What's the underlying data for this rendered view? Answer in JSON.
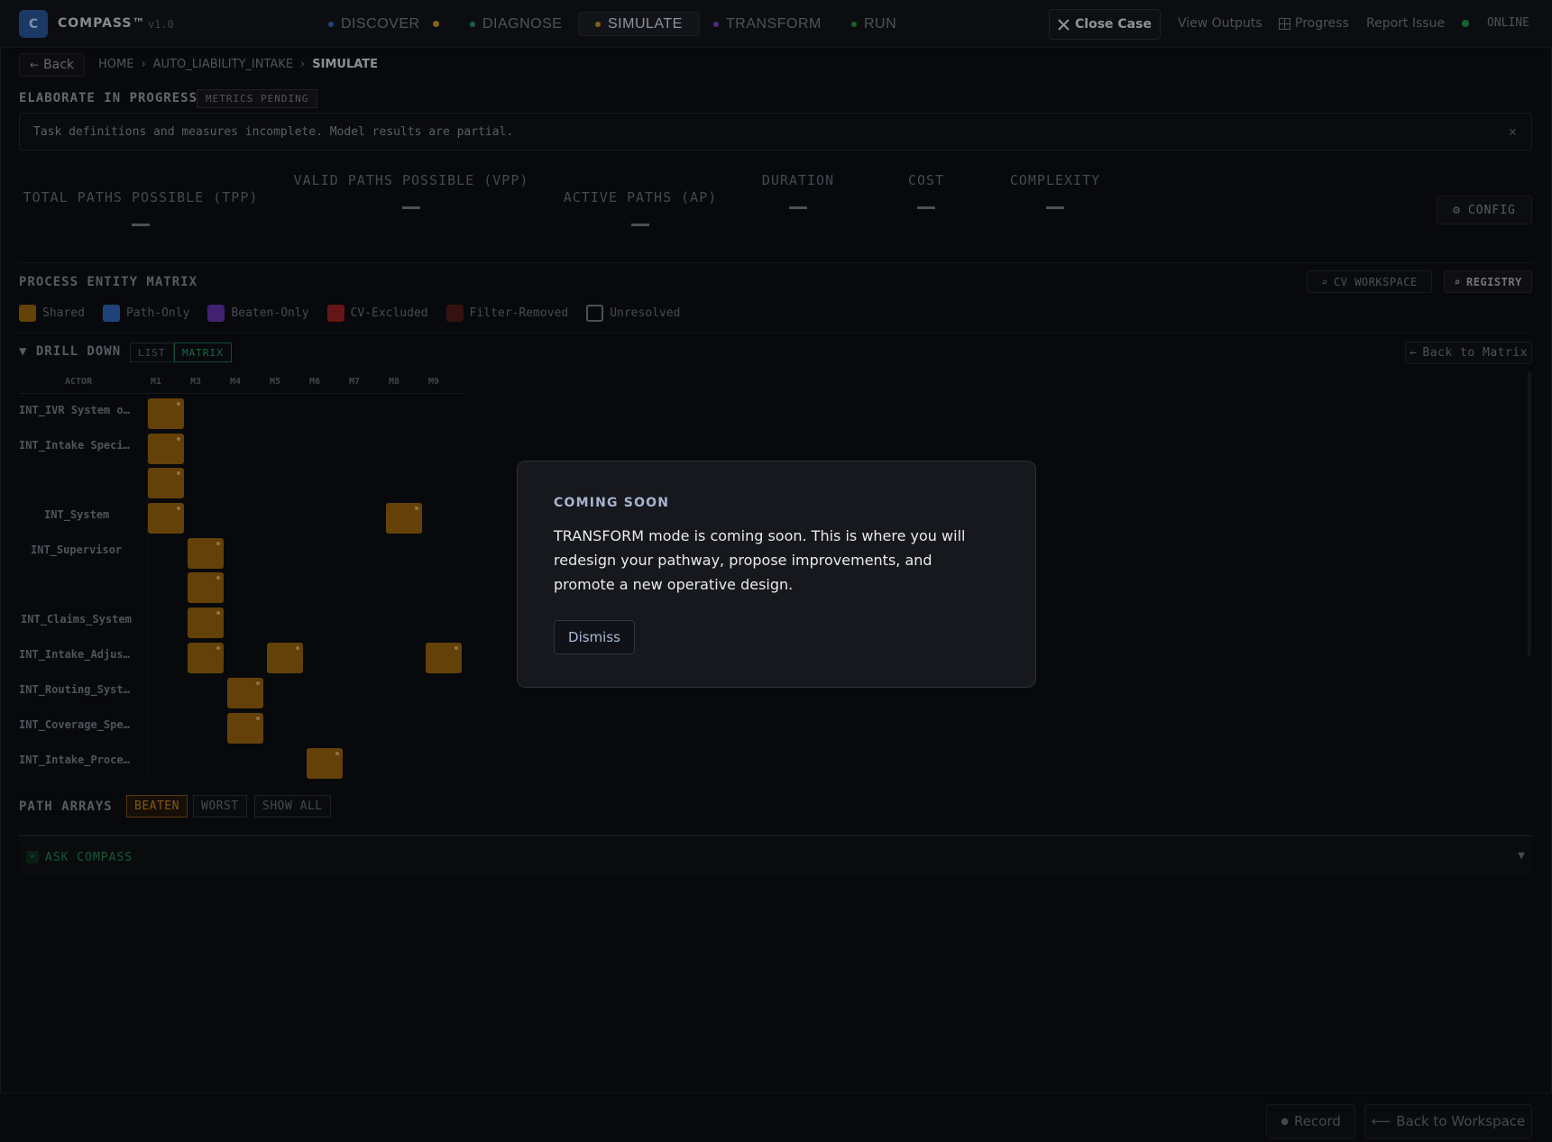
{
  "app": {
    "logo_letter": "C",
    "name": "COMPASS™",
    "version": "v1.0"
  },
  "modes": [
    {
      "label": "DISCOVER",
      "dot_color": "#2a5ea8",
      "trailing_dot": true
    },
    {
      "label": "DIAGNOSE",
      "dot_color": "#1e8a56",
      "trailing_dot": false
    },
    {
      "label": "SIMULATE",
      "dot_color": "#b8862a",
      "trailing_dot": false,
      "active": true
    },
    {
      "label": "TRANSFORM",
      "dot_color": "#6a3bb5",
      "trailing_dot": false
    },
    {
      "label": "RUN",
      "dot_color": "#1e8a3e",
      "trailing_dot": false
    }
  ],
  "topbar": {
    "close_case": "Close Case",
    "view_outputs": "View Outputs",
    "progress": "Progress",
    "report_issue": "Report Issue",
    "status": "ONLINE"
  },
  "breadcrumb": {
    "back": "Back",
    "items": [
      "HOME",
      "AUTO_LIABILITY_INTAKE",
      "SIMULATE"
    ]
  },
  "status": {
    "title": "ELABORATE IN PROGRESS",
    "badge": "METRICS PENDING",
    "notice": "Task definitions and measures incomplete. Model results are partial.",
    "dismiss_glyph": "×"
  },
  "metrics": [
    {
      "label": "TOTAL PATHS POSSIBLE (TPP)",
      "value": ""
    },
    {
      "label": "VALID PATHS POSSIBLE (VPP)",
      "value": ""
    },
    {
      "label": "ACTIVE PATHS (AP)",
      "value": ""
    },
    {
      "label": "DURATION",
      "value": ""
    },
    {
      "label": "COST",
      "value": ""
    },
    {
      "label": "COMPLEXITY",
      "value": ""
    }
  ],
  "config_label": "CONFIG",
  "matrix": {
    "title": "PROCESS ENTITY MATRIX",
    "cv_workspace": "CV WORKSPACE",
    "registry": "REGISTRY",
    "legend": [
      {
        "label": "Shared",
        "color": "#8a5a0d"
      },
      {
        "label": "Path-Only",
        "color": "#2a5ea8"
      },
      {
        "label": "Beaten-Only",
        "color": "#5b2f9c"
      },
      {
        "label": "CV-Excluded",
        "color": "#8c1f1f"
      },
      {
        "label": "Filter-Removed",
        "color": "#4a1a1a"
      },
      {
        "label": "Unresolved",
        "color": "outline"
      }
    ],
    "drill_down": "▼ DRILL DOWN",
    "view_list": "LIST",
    "view_matrix": "MATRIX",
    "back_to_matrix": "Back to Matrix",
    "actor_header": "ACTOR",
    "columns": [
      "M1",
      "M3",
      "M4",
      "M5",
      "M6",
      "M7",
      "M8",
      "M9"
    ],
    "actors": [
      "INT_IVR System o…",
      "INT_Intake Speci…",
      "",
      "INT_System",
      "INT_Supervisor",
      "",
      "INT_Claims_System",
      "INT_Intake_Adjus…",
      "INT_Routing_Syst…",
      "INT_Coverage_Spe…",
      "INT_Intake_Proce…"
    ],
    "cells": [
      {
        "row": 0,
        "col": 0
      },
      {
        "row": 1,
        "col": 0
      },
      {
        "row": 2,
        "col": 0
      },
      {
        "row": 3,
        "col": 0
      },
      {
        "row": 3,
        "col": 6
      },
      {
        "row": 4,
        "col": 1
      },
      {
        "row": 5,
        "col": 1
      },
      {
        "row": 6,
        "col": 1
      },
      {
        "row": 7,
        "col": 1
      },
      {
        "row": 7,
        "col": 3
      },
      {
        "row": 7,
        "col": 7
      },
      {
        "row": 8,
        "col": 2
      },
      {
        "row": 9,
        "col": 2
      },
      {
        "row": 10,
        "col": 4
      }
    ]
  },
  "path_arrays": {
    "title": "PATH ARRAYS",
    "buttons": [
      "BEATEN",
      "WORST",
      "SHOW ALL"
    ]
  },
  "ask": {
    "label": "ASK COMPASS",
    "icon_glyph": "⌕",
    "chevron": "▼"
  },
  "footer": {
    "record": "Record",
    "back_to_workspace": "Back to Workspace"
  },
  "modal": {
    "title": "COMING SOON",
    "body": "TRANSFORM mode is coming soon. This is where you will redesign your pathway, propose improvements, and promote a new operative design.",
    "dismiss": "Dismiss"
  }
}
